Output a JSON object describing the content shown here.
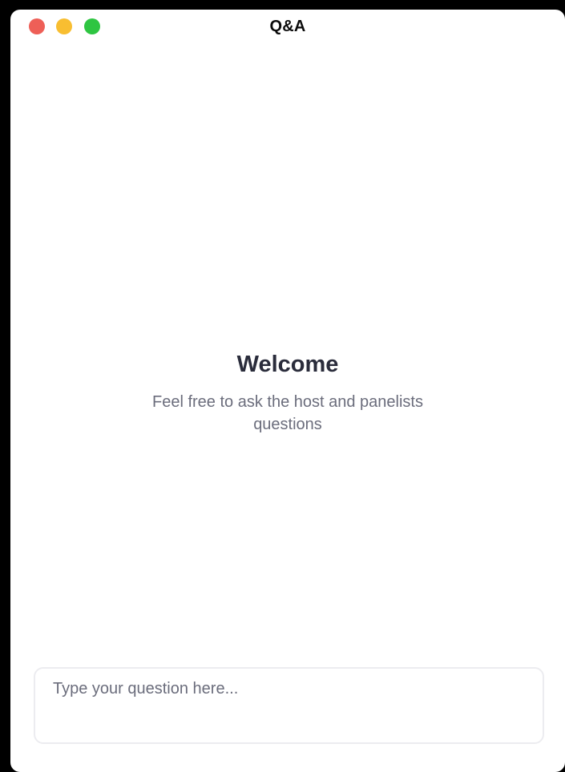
{
  "window": {
    "title": "Q&A"
  },
  "welcome": {
    "title": "Welcome",
    "subtitle": "Feel free to ask the host and panelists questions"
  },
  "question_input": {
    "value": "",
    "placeholder": "Type your question here..."
  },
  "colors": {
    "close": "#ee5f57",
    "minimize": "#f8be31",
    "zoom": "#2ec541",
    "heading": "#2a2c3b",
    "muted_text": "#6b6d7c",
    "input_border": "#ececf0"
  }
}
